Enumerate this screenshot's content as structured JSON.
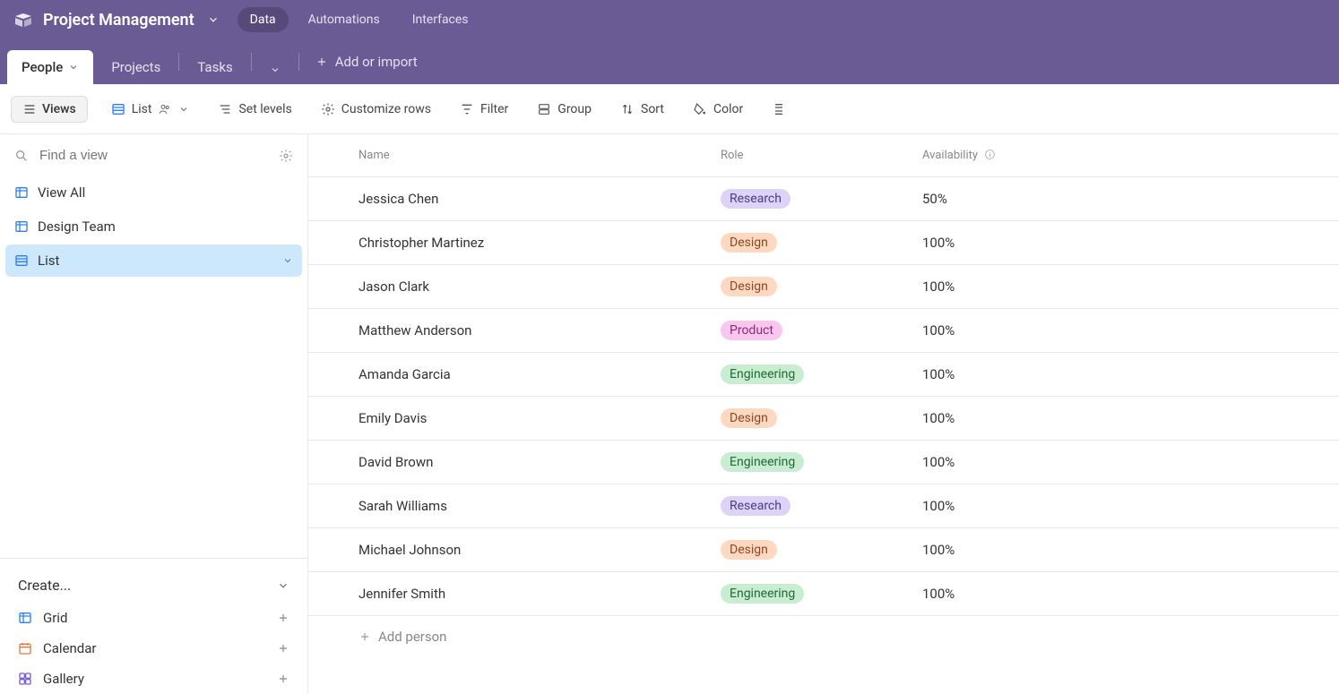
{
  "header": {
    "app_title": "Project Management",
    "nav": {
      "data": "Data",
      "automations": "Automations",
      "interfaces": "Interfaces"
    }
  },
  "tabs": {
    "people": "People",
    "projects": "Projects",
    "tasks": "Tasks",
    "add_import": "Add or import"
  },
  "toolbar": {
    "views": "Views",
    "list": "List",
    "set_levels": "Set levels",
    "customize": "Customize rows",
    "filter": "Filter",
    "group": "Group",
    "sort": "Sort",
    "color": "Color"
  },
  "sidebar": {
    "search_placeholder": "Find a view",
    "views": [
      {
        "label": "View All",
        "type": "grid"
      },
      {
        "label": "Design Team",
        "type": "grid"
      },
      {
        "label": "List",
        "type": "list"
      }
    ],
    "create_label": "Create...",
    "create_items": [
      {
        "label": "Grid",
        "icon": "grid"
      },
      {
        "label": "Calendar",
        "icon": "calendar"
      },
      {
        "label": "Gallery",
        "icon": "gallery"
      }
    ]
  },
  "table": {
    "columns": {
      "name": "Name",
      "role": "Role",
      "availability": "Availability"
    },
    "rows": [
      {
        "name": "Jessica Chen",
        "role": "Research",
        "availability": "50%"
      },
      {
        "name": "Christopher Martinez",
        "role": "Design",
        "availability": "100%"
      },
      {
        "name": "Jason Clark",
        "role": "Design",
        "availability": "100%"
      },
      {
        "name": "Matthew Anderson",
        "role": "Product",
        "availability": "100%"
      },
      {
        "name": "Amanda Garcia",
        "role": "Engineering",
        "availability": "100%"
      },
      {
        "name": "Emily Davis",
        "role": "Design",
        "availability": "100%"
      },
      {
        "name": "David Brown",
        "role": "Engineering",
        "availability": "100%"
      },
      {
        "name": "Sarah Williams",
        "role": "Research",
        "availability": "100%"
      },
      {
        "name": "Michael Johnson",
        "role": "Design",
        "availability": "100%"
      },
      {
        "name": "Jennifer Smith",
        "role": "Engineering",
        "availability": "100%"
      }
    ],
    "add_person": "Add person"
  }
}
